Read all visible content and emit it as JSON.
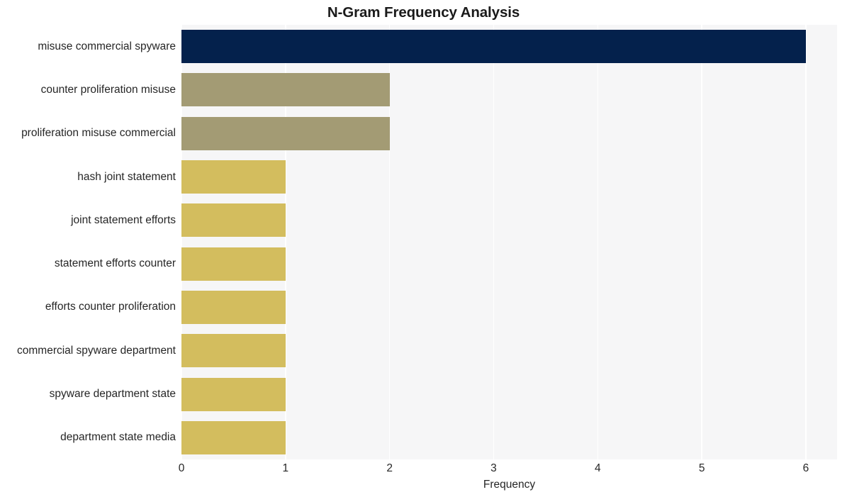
{
  "chart_data": {
    "type": "bar",
    "orientation": "horizontal",
    "title": "N-Gram Frequency Analysis",
    "xlabel": "Frequency",
    "ylabel": "",
    "xlim": [
      0,
      6.3
    ],
    "xticks": [
      0,
      1,
      2,
      3,
      4,
      5,
      6
    ],
    "xtick_labels": [
      "0",
      "1",
      "2",
      "3",
      "4",
      "5",
      "6"
    ],
    "grid": "vertical-white",
    "legend": "none",
    "categories": [
      "misuse commercial spyware",
      "counter proliferation misuse",
      "proliferation misuse commercial",
      "hash joint statement",
      "joint statement efforts",
      "statement efforts counter",
      "efforts counter proliferation",
      "commercial spyware department",
      "spyware department state",
      "department state media"
    ],
    "values": [
      6,
      2,
      2,
      1,
      1,
      1,
      1,
      1,
      1,
      1
    ],
    "bar_colors": [
      "#04214c",
      "#a39b74",
      "#a39b74",
      "#d3bd5e",
      "#d3bd5e",
      "#d3bd5e",
      "#d3bd5e",
      "#d3bd5e",
      "#d3bd5e",
      "#d3bd5e"
    ]
  },
  "style": {
    "figure_background": "#ffffff",
    "plot_background": "#f6f6f7",
    "grid_color": "#ffffff",
    "text_color": "#262626",
    "title_color": "#1a1a1a"
  }
}
